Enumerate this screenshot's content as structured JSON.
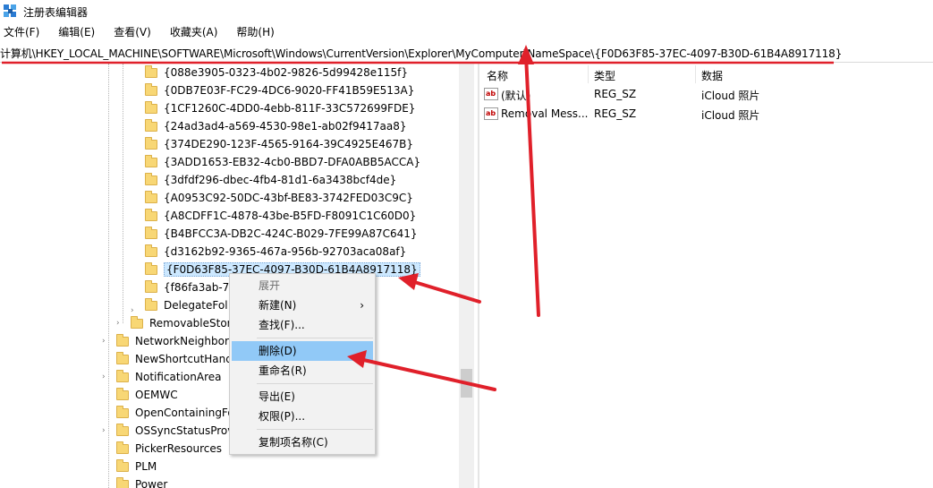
{
  "window": {
    "title": "注册表编辑器"
  },
  "menu": [
    "文件(F)",
    "编辑(E)",
    "查看(V)",
    "收藏夹(A)",
    "帮助(H)"
  ],
  "address": "计算机\\HKEY_LOCAL_MACHINE\\SOFTWARE\\Microsoft\\Windows\\CurrentVersion\\Explorer\\MyComputer\\NameSpace\\{F0D63F85-37EC-4097-B30D-61B4A8917118}",
  "tree": {
    "namespace_keys": [
      "{088e3905-0323-4b02-9826-5d99428e115f}",
      "{0DB7E03F-FC29-4DC6-9020-FF41B59E513A}",
      "{1CF1260C-4DD0-4ebb-811F-33C572699FDE}",
      "{24ad3ad4-a569-4530-98e1-ab02f9417aa8}",
      "{374DE290-123F-4565-9164-39C4925E467B}",
      "{3ADD1653-EB32-4cb0-BBD7-DFA0ABB5ACCA}",
      "{3dfdf296-dbec-4fb4-81d1-6a3438bcf4de}",
      "{A0953C92-50DC-43bf-BE83-3742FED03C9C}",
      "{A8CDFF1C-4878-43be-B5FD-F8091C1C60D0}",
      "{B4BFCC3A-DB2C-424C-B029-7FE99A87C641}",
      "{d3162b92-9365-467a-956b-92703aca08af}",
      "{F0D63F85-37EC-4097-B30D-61B4A8917118}",
      "{f86fa3ab-70"
    ],
    "delegate": "DelegateFol",
    "removable": "RemovableStor",
    "explorer_siblings": [
      "NetworkNeighbor",
      "NewShortcutHand",
      "NotificationArea",
      "OEMWC",
      "OpenContainingFo",
      "OSSyncStatusProv",
      "PickerResources",
      "PLM",
      "Power"
    ]
  },
  "list": {
    "headers": {
      "name": "名称",
      "type": "类型",
      "data": "数据"
    },
    "rows": [
      {
        "icon": "ab",
        "name": "(默认)",
        "type": "REG_SZ",
        "data": "iCloud 照片"
      },
      {
        "icon": "ab",
        "name": "Removal Mess...",
        "type": "REG_SZ",
        "data": "iCloud 照片"
      }
    ]
  },
  "context_menu": {
    "expand": "展开",
    "new": "新建(N)",
    "find": "查找(F)...",
    "delete": "删除(D)",
    "rename": "重命名(R)",
    "export": "导出(E)",
    "permissions": "权限(P)...",
    "copy_name": "复制项名称(C)"
  },
  "colors": {
    "annotation": "#e0202a",
    "selection": "#cce8ff",
    "menu_hover": "#91c9f7",
    "folder": "#f8d775"
  }
}
